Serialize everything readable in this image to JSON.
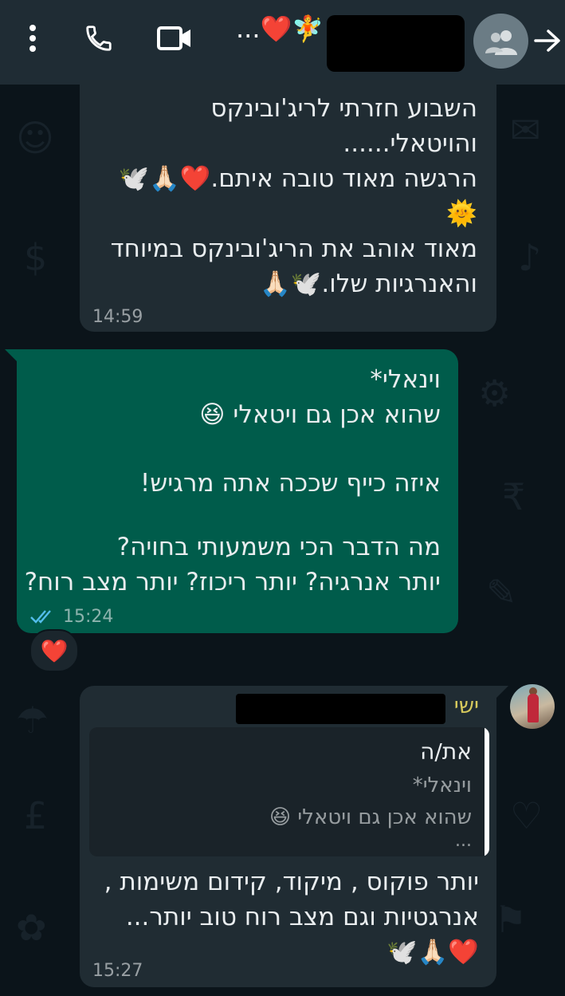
{
  "header": {
    "status_text": "...❤️🧚",
    "icons": [
      "more-vert-icon",
      "phone-icon",
      "video-icon",
      "group-avatar-icon",
      "back-arrow-icon"
    ]
  },
  "messages": [
    {
      "direction": "incoming",
      "lines": [
        "השבוע חזרתי לריג'ובינקס",
        "והויטאלי......",
        "הרגשה מאוד טובה איתם.❤️🙏🏻🕊️",
        "🌞",
        "מאוד אוהב את הריג'ובינקס במיוחד",
        "והאנרגיות שלו.🕊️🙏🏻"
      ],
      "time": "14:59"
    },
    {
      "direction": "outgoing",
      "lines": [
        "וינאלי*",
        "שהוא אכן גם ויטאלי 😆",
        "",
        "איזה כייף שככה אתה מרגיש!",
        "",
        "מה הדבר הכי משמעותי בחויה?",
        "יותר אנרגיה? יותר ריכוז? יותר מצב רוח?"
      ],
      "time": "15:24",
      "reaction": "❤️"
    },
    {
      "direction": "incoming",
      "sender": "ישי",
      "quote": {
        "author": "את/ה",
        "line1": "וינאלי*",
        "line2": "שהוא אכן גם ויטאלי 😆",
        "more": "..."
      },
      "lines": [
        "יותר פוקוס , מיקוד, קידום משימות ,",
        "אנרגטיות וגם מצב רוח טוב יותר...",
        "❤️🙏🏻🕊️"
      ],
      "time": "15:27"
    }
  ],
  "colors": {
    "background": "#0b141a",
    "header": "#1f2c34",
    "incoming_bubble": "#202c33",
    "outgoing_bubble": "#005c4b",
    "sender_name": "#d6c95c",
    "read_ticks": "#53bdeb"
  }
}
